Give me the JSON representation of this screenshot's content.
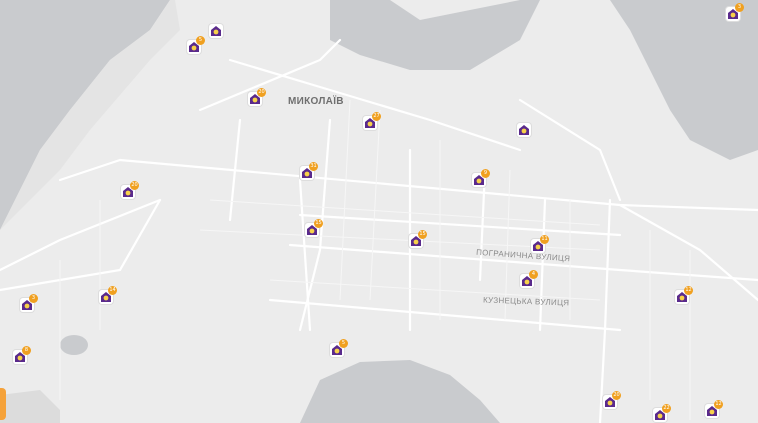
{
  "map": {
    "city_label": "МИКОЛАЇВ",
    "street_labels": [
      "ПОГРАНИЧНА ВУЛИЦЯ",
      "КУЗНЕЦЬКА ВУЛИЦЯ"
    ]
  },
  "colors": {
    "water": "#c9cbce",
    "land": "#ececec",
    "road": "#ffffff",
    "marker_purple": "#5a2a8c",
    "marker_badge": "#f0a020",
    "side_tab": "#f5a23a"
  },
  "markers": [
    {
      "count": "",
      "icon": "store-icon"
    },
    {
      "count": "5",
      "icon": "store-icon"
    },
    {
      "count": "20",
      "icon": "store-icon"
    },
    {
      "count": "27",
      "icon": "store-icon"
    },
    {
      "count": "",
      "icon": "store-icon"
    },
    {
      "count": "31",
      "icon": "store-icon"
    },
    {
      "count": "9",
      "icon": "store-icon"
    },
    {
      "count": "20",
      "icon": "store-icon"
    },
    {
      "count": "15",
      "icon": "store-icon"
    },
    {
      "count": "15",
      "icon": "store-icon"
    },
    {
      "count": "11",
      "icon": "store-icon"
    },
    {
      "count": "4",
      "icon": "store-icon"
    },
    {
      "count": "3",
      "icon": "store-icon"
    },
    {
      "count": "14",
      "icon": "store-icon"
    },
    {
      "count": "12",
      "icon": "store-icon"
    },
    {
      "count": "8",
      "icon": "store-icon"
    },
    {
      "count": "5",
      "icon": "store-icon"
    },
    {
      "count": "20",
      "icon": "store-icon"
    },
    {
      "count": "22",
      "icon": "store-icon"
    },
    {
      "count": "12",
      "icon": "store-icon"
    },
    {
      "count": "3",
      "icon": "store-icon"
    }
  ]
}
